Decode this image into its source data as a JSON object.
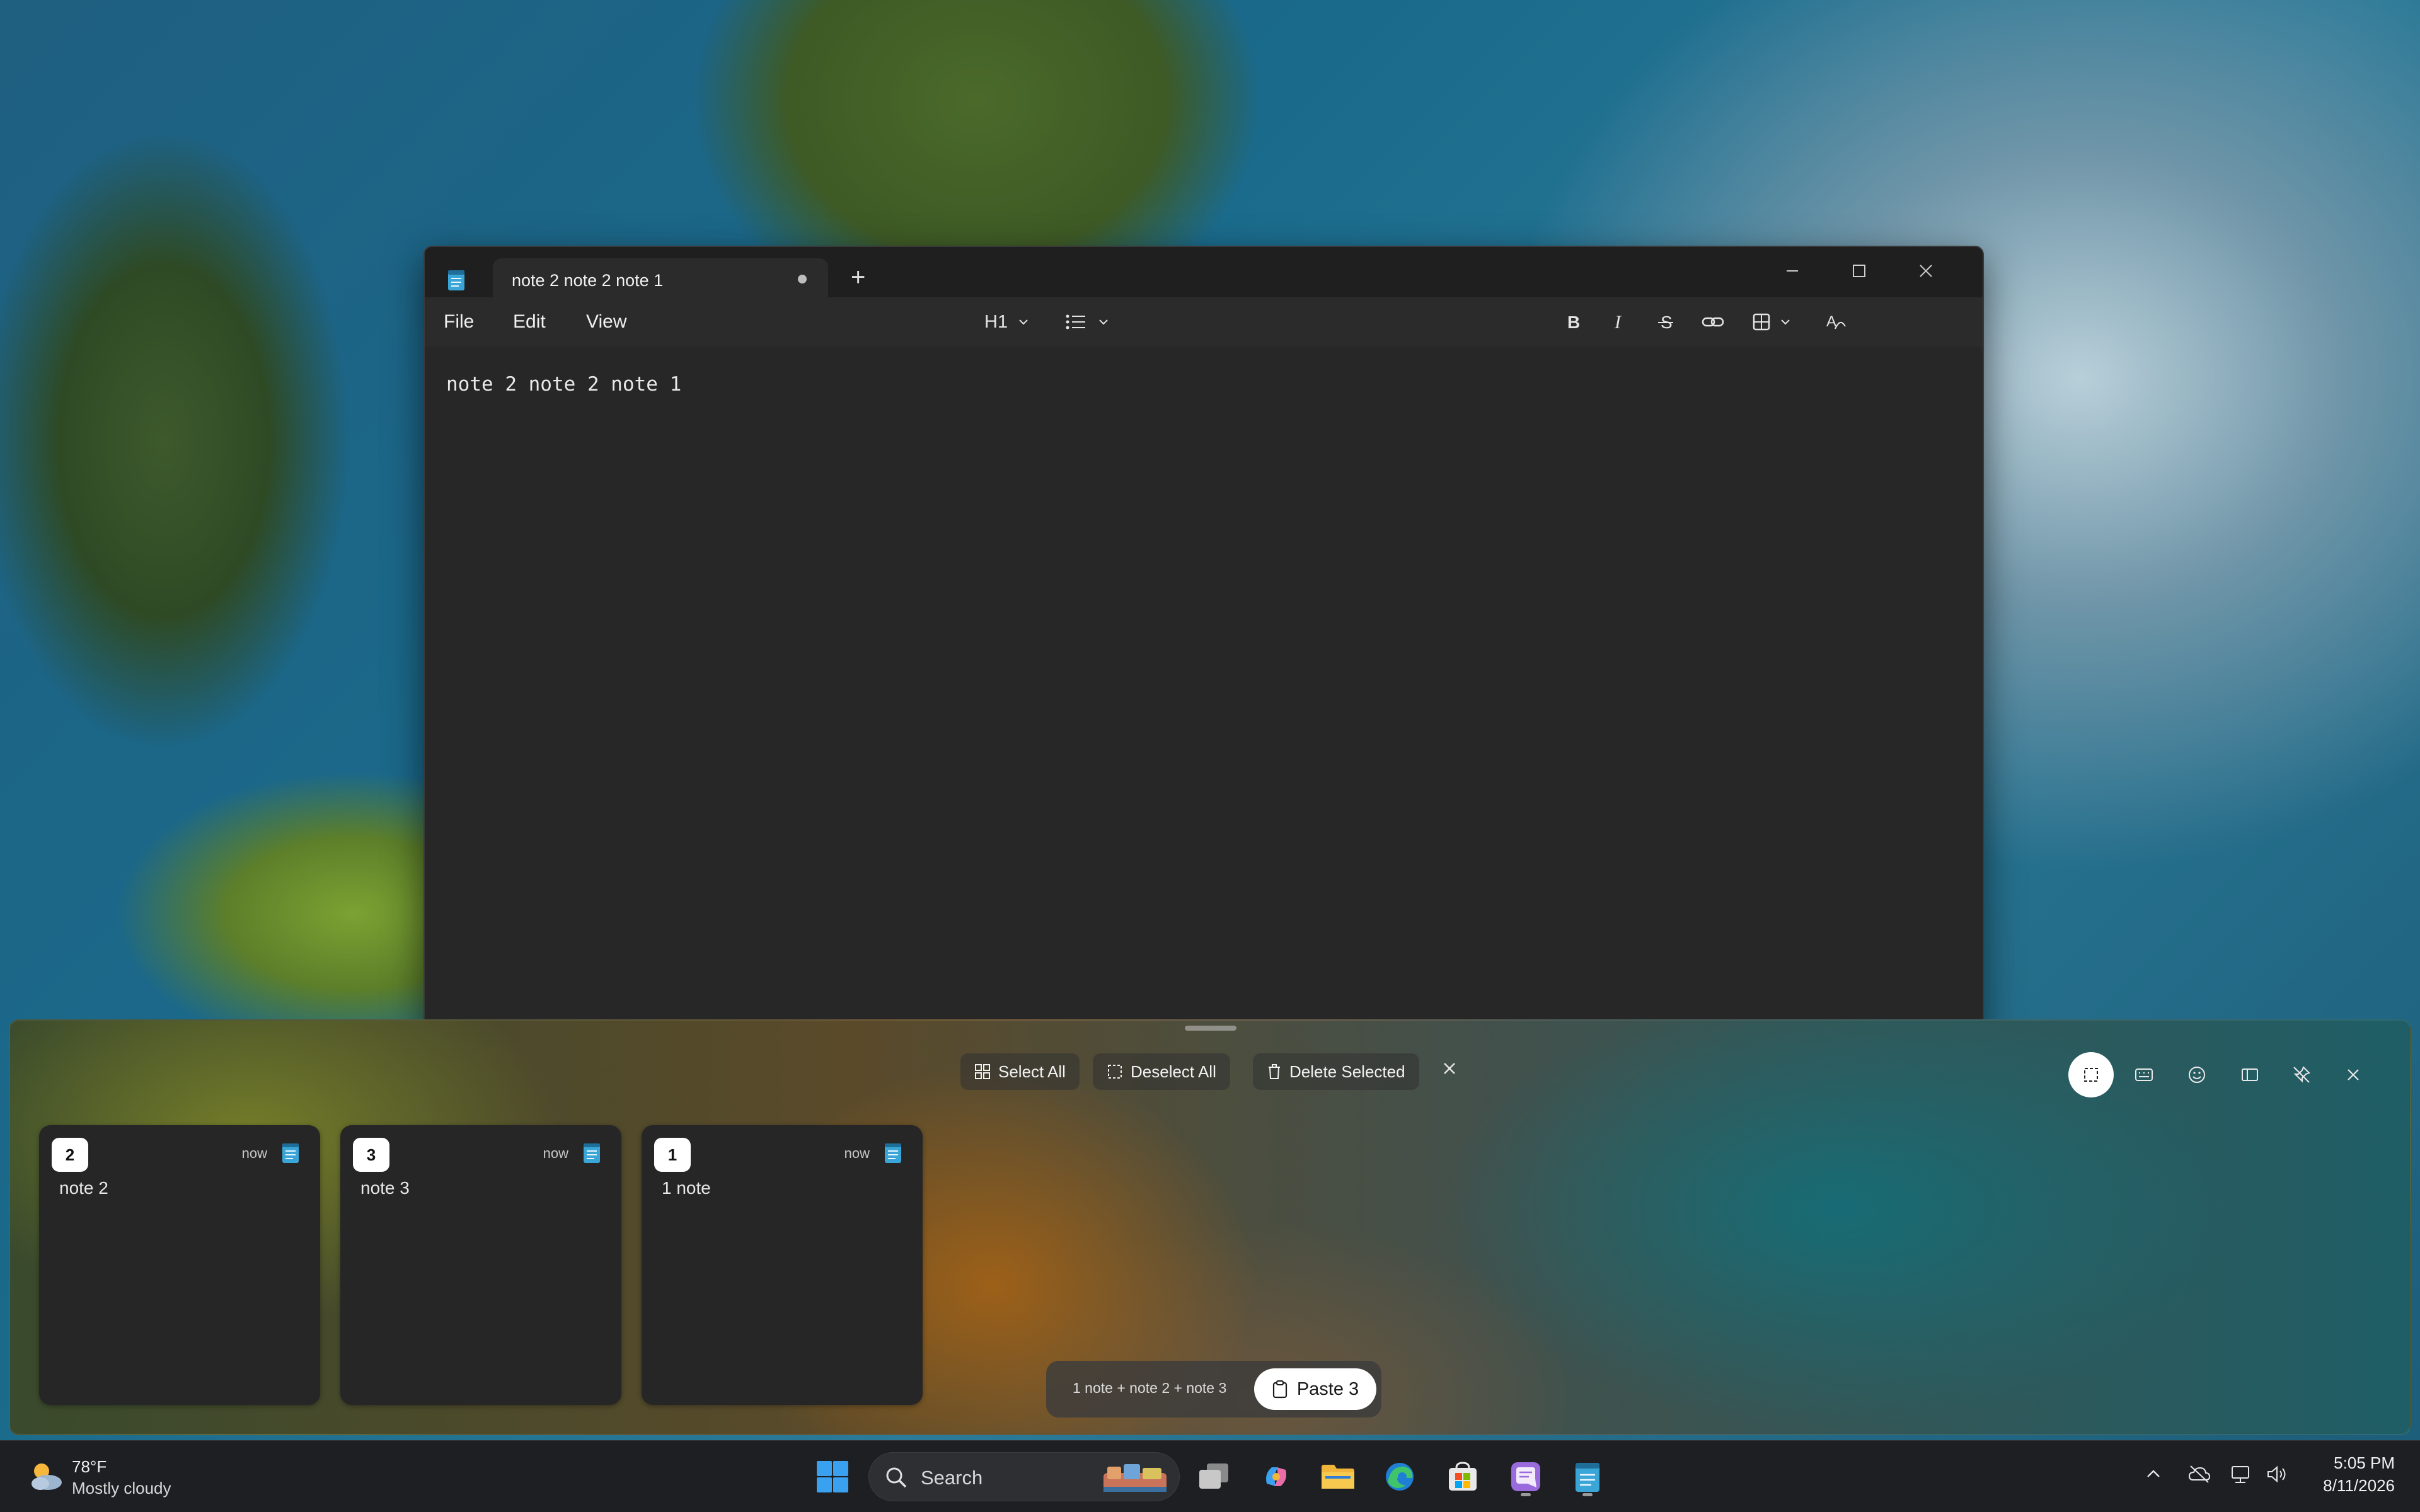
{
  "notepad": {
    "tab_title": "note 2 note 2 note 1",
    "menu": [
      "File",
      "Edit",
      "View"
    ],
    "toolbar": {
      "heading": "H1",
      "icons": [
        "list-icon",
        "bold-icon",
        "italic-icon",
        "strikethrough-icon",
        "link-icon",
        "table-icon",
        "clear-formatting-icon",
        "copilot-write-icon",
        "announcement-icon",
        "account-icon",
        "gear-icon"
      ]
    },
    "content": "note 2 note 2 note 1"
  },
  "clipboard": {
    "actions": {
      "select_all": "Select All",
      "deselect_all": "Deselect All",
      "delete_selected": "Delete Selected"
    },
    "items": [
      {
        "badge": "2",
        "time": "now",
        "text": "note 2"
      },
      {
        "badge": "3",
        "time": "now",
        "text": "note 3"
      },
      {
        "badge": "1",
        "time": "now",
        "text": "1 note"
      }
    ],
    "paste_summary": "1 note + note 2 + note 3",
    "paste_label": "Paste 3"
  },
  "taskbar": {
    "weather_temp": "78°F",
    "weather_desc": "Mostly cloudy",
    "search_label": "Search",
    "time": "5:05 PM",
    "date": "8/11/2026"
  },
  "colors": {
    "accent_blue": "#4cc2ff",
    "windows_logo": "#3aa0f0"
  }
}
